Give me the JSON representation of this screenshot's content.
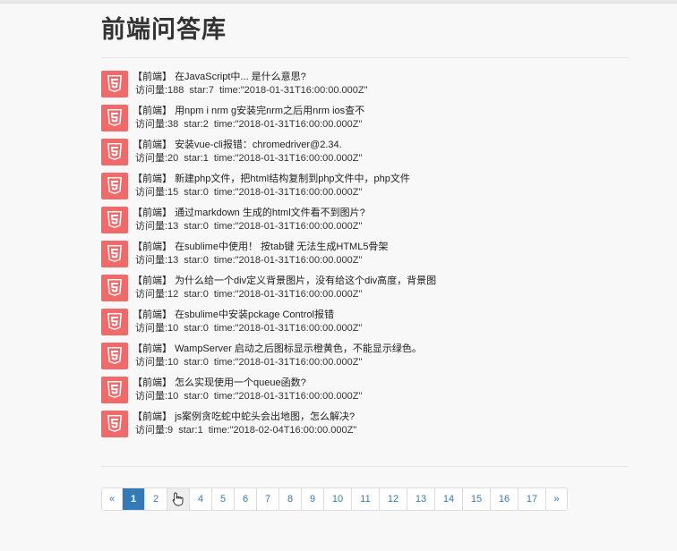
{
  "page": {
    "title": "前端问答库"
  },
  "questions": [
    {
      "tag": "【前端】",
      "title": "在JavaScript中... 是什么意思?",
      "views": "访问量:188",
      "stars": "star:7",
      "time": "time:\"2018-01-31T16:00:00.000Z\""
    },
    {
      "tag": "【前端】",
      "title": "用npm i nrm g安装完nrm之后用nrm ios查不",
      "views": "访问量:38",
      "stars": "star:2",
      "time": "time:\"2018-01-31T16:00:00.000Z\""
    },
    {
      "tag": "【前端】",
      "title": "安装vue-cli报错：chromedriver@2.34.",
      "views": "访问量:20",
      "stars": "star:1",
      "time": "time:\"2018-01-31T16:00:00.000Z\""
    },
    {
      "tag": "【前端】",
      "title": "新建php文件，把html结构复制到php文件中，php文件",
      "views": "访问量:15",
      "stars": "star:0",
      "time": "time:\"2018-01-31T16:00:00.000Z\""
    },
    {
      "tag": "【前端】",
      "title": "通过markdown 生成的html文件看不到图片?",
      "views": "访问量:13",
      "stars": "star:0",
      "time": "time:\"2018-01-31T16:00:00.000Z\""
    },
    {
      "tag": "【前端】",
      "title": "在sublime中使用！ 按tab键 无法生成HTML5骨架",
      "views": "访问量:13",
      "stars": "star:0",
      "time": "time:\"2018-01-31T16:00:00.000Z\""
    },
    {
      "tag": "【前端】",
      "title": "为什么给一个div定义背景图片，没有给这个div高度，背景图",
      "views": "访问量:12",
      "stars": "star:0",
      "time": "time:\"2018-01-31T16:00:00.000Z\""
    },
    {
      "tag": "【前端】",
      "title": "在sbulime中安装pckage Control报错",
      "views": "访问量:10",
      "stars": "star:0",
      "time": "time:\"2018-01-31T16:00:00.000Z\""
    },
    {
      "tag": "【前端】",
      "title": "WampServer 启动之后图标显示橙黄色，不能显示绿色。",
      "views": "访问量:10",
      "stars": "star:0",
      "time": "time:\"2018-01-31T16:00:00.000Z\""
    },
    {
      "tag": "【前端】",
      "title": "怎么实现使用一个queue函数?",
      "views": "访问量:10",
      "stars": "star:0",
      "time": "time:\"2018-01-31T16:00:00.000Z\""
    },
    {
      "tag": "【前端】",
      "title": "js案例贪吃蛇中蛇头会出地图，怎么解决?",
      "views": "访问量:9",
      "stars": "star:1",
      "time": "time:\"2018-02-04T16:00:00.000Z\""
    }
  ],
  "pagination": {
    "prev": "«",
    "next": "»",
    "pages": [
      "1",
      "2",
      "3",
      "4",
      "5",
      "6",
      "7",
      "8",
      "9",
      "10",
      "11",
      "12",
      "13",
      "14",
      "15",
      "16",
      "17"
    ],
    "active": "1",
    "hovered": "3"
  },
  "icons": {
    "question_badge": "html5-icon",
    "cursor": "hand-pointer-icon"
  },
  "colors": {
    "badge": "#f06a6a",
    "link": "#337ab7",
    "active_page": "#337ab7"
  }
}
